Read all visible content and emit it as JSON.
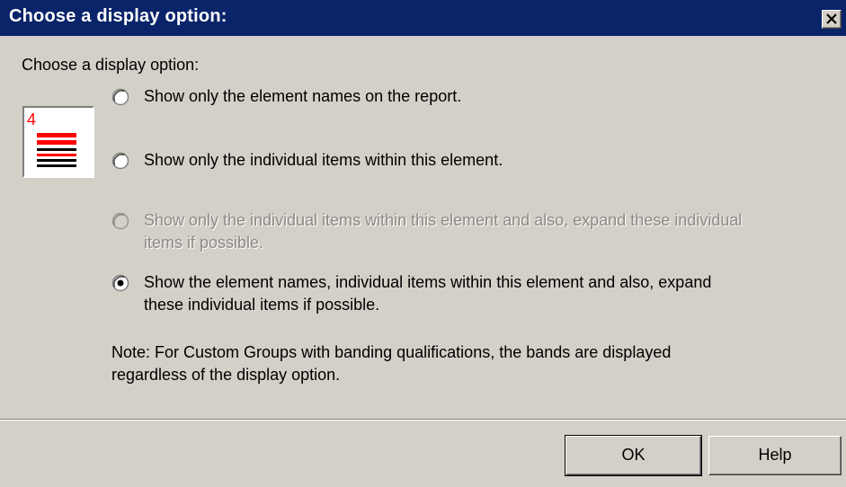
{
  "dialog": {
    "title": "Choose a display option:",
    "close_icon": "close-icon",
    "prompt": "Choose a display option:",
    "preview_icon": "report-layout-icon",
    "preview_marker": "4",
    "options": [
      {
        "label": "Show only the element names on the report.",
        "selected": false,
        "enabled": true
      },
      {
        "label": "Show only the individual items within this element.",
        "selected": false,
        "enabled": true
      },
      {
        "label_line1": "Show only the individual items within this element and also, expand these individual",
        "label_line2": "items if possible.",
        "selected": false,
        "enabled": false
      },
      {
        "label_line1": "Show the element names, individual items within this element and also, expand",
        "label_line2": "these individual items if possible.",
        "selected": true,
        "enabled": true
      }
    ],
    "note_line1": "Note: For Custom Groups with banding qualifications, the bands are displayed",
    "note_line2": "regardless of the display option.",
    "buttons": {
      "ok": "OK",
      "help": "Help"
    }
  },
  "colors": {
    "titlebar": "#0a246a",
    "face": "#d4d0c8",
    "preview_red": "#ff0000",
    "disabled_text": "#8d8a85"
  }
}
